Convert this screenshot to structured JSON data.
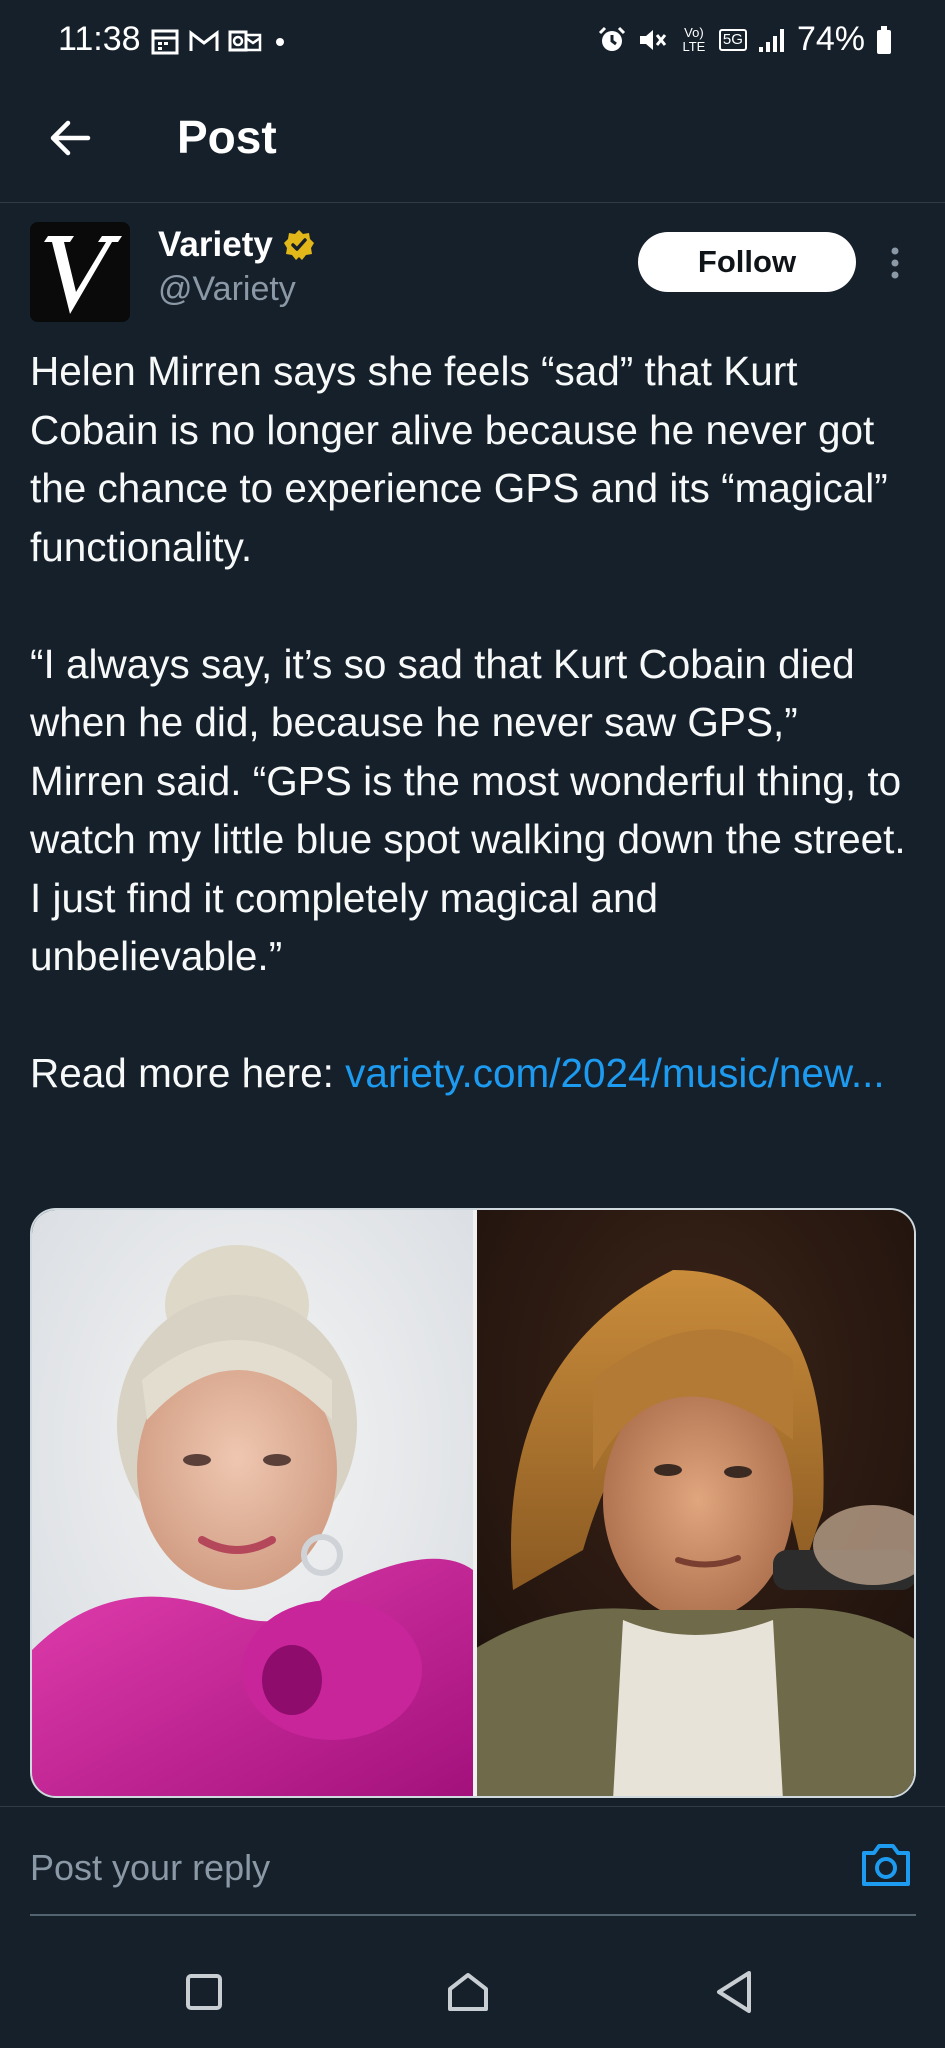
{
  "status_bar": {
    "time": "11:38",
    "battery": "74%",
    "icons_left": [
      "calendar-icon",
      "gmail-icon",
      "outlook-icon",
      "dot-icon"
    ],
    "icons_right": [
      "alarm-icon",
      "mute-icon",
      "volte-icon",
      "5g-icon",
      "signal-icon",
      "battery-icon"
    ],
    "volte_label": "Vo) LTE",
    "network_label": "5G"
  },
  "header": {
    "title": "Post"
  },
  "author": {
    "name": "Variety",
    "handle": "@Variety",
    "verified": true,
    "verified_color": "#e2b719",
    "logo_letter": "V",
    "follow_label": "Follow"
  },
  "post": {
    "paragraph_1": "Helen Mirren says she feels “sad” that Kurt Cobain is no longer alive because he never got the chance to experience GPS and its “magical” functionality.",
    "paragraph_2": "“I always say, it’s so sad that Kurt Cobain died when he did, because he never saw GPS,” Mirren said. “GPS is the most wonderful thing, to watch my little blue spot walking down the street. I just find it completely magical and unbelievable.”",
    "read_more_prefix": "Read more here: ",
    "link_text": "variety.com/2024/music/new...",
    "link_color": "#1d9bf0"
  },
  "media": {
    "images": [
      "helen-mirren-photo",
      "kurt-cobain-photo"
    ]
  },
  "reply": {
    "placeholder": "Post your reply"
  },
  "nav": {
    "buttons": [
      "recents-button",
      "home-button",
      "back-button"
    ]
  },
  "colors": {
    "background": "#15202b",
    "secondary_text": "#8b98a5",
    "accent": "#1d9bf0"
  }
}
